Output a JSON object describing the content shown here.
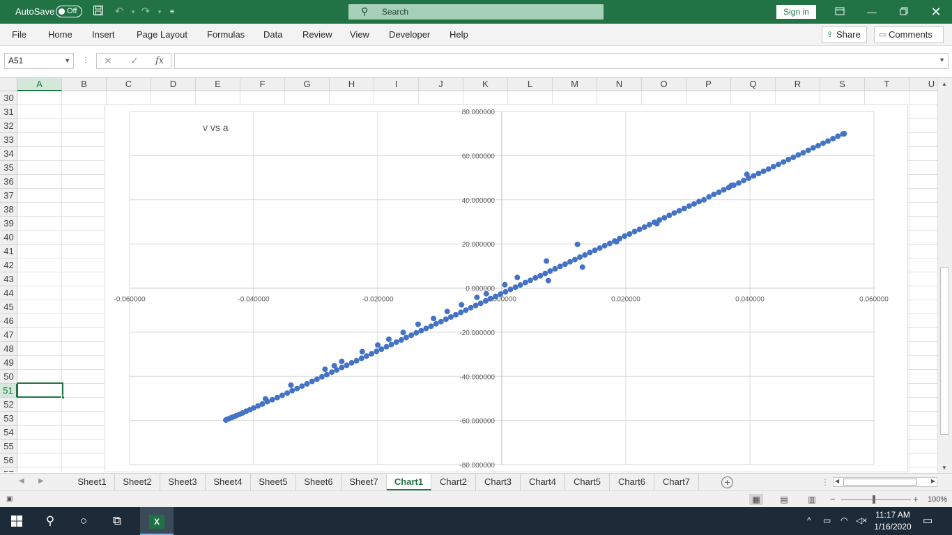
{
  "titlebar": {
    "autosave_label": "AutoSave",
    "autosave_state": "Off",
    "search_placeholder": "Search",
    "signin_label": "Sign in"
  },
  "ribbon": {
    "tabs": [
      "File",
      "Home",
      "Insert",
      "Page Layout",
      "Formulas",
      "Data",
      "Review",
      "View",
      "Developer",
      "Help"
    ],
    "share_label": "Share",
    "comments_label": "Comments"
  },
  "formula_bar": {
    "name_box": "A51",
    "fx_label": "fx",
    "formula_value": ""
  },
  "grid": {
    "columns": [
      "A",
      "B",
      "C",
      "D",
      "E",
      "F",
      "G",
      "H",
      "I",
      "J",
      "K",
      "L",
      "M",
      "N",
      "O",
      "P",
      "Q",
      "R",
      "S",
      "T",
      "U"
    ],
    "selected_column": "A",
    "rows": [
      "30",
      "31",
      "32",
      "33",
      "34",
      "35",
      "36",
      "37",
      "38",
      "39",
      "40",
      "41",
      "42",
      "43",
      "44",
      "45",
      "46",
      "47",
      "48",
      "49",
      "50",
      "51",
      "52",
      "53",
      "54",
      "55",
      "56",
      "57"
    ],
    "selected_row": "51"
  },
  "chart_data": {
    "type": "scatter",
    "title": "v vs a",
    "xlabel": "",
    "ylabel": "",
    "xlim": [
      -0.06,
      0.06
    ],
    "ylim": [
      -80,
      80
    ],
    "x_ticks": [
      "-0.060000",
      "-0.040000",
      "-0.020000",
      "0.000000",
      "0.020000",
      "0.040000",
      "0.060000"
    ],
    "y_ticks": [
      "80.000000",
      "60.000000",
      "40.000000",
      "20.000000",
      "0.000000",
      "-20.000000",
      "-40.000000",
      "-60.000000",
      "-80.000000"
    ],
    "grid": true,
    "marker_color": "#4472c4",
    "points": [
      [
        -0.0445,
        -59.8
      ],
      [
        -0.0443,
        -59.5
      ],
      [
        -0.044,
        -59.2
      ],
      [
        -0.0436,
        -58.7
      ],
      [
        -0.0432,
        -58.3
      ],
      [
        -0.0428,
        -57.8
      ],
      [
        -0.0423,
        -57.2
      ],
      [
        -0.0418,
        -56.6
      ],
      [
        -0.0412,
        -55.8
      ],
      [
        -0.0406,
        -55.1
      ],
      [
        -0.04,
        -54.3
      ],
      [
        -0.0393,
        -53.4
      ],
      [
        -0.0386,
        -52.5
      ],
      [
        -0.0378,
        -51.4
      ],
      [
        -0.0381,
        -50.2
      ],
      [
        -0.037,
        -50.6
      ],
      [
        -0.0362,
        -49.6
      ],
      [
        -0.0354,
        -48.6
      ],
      [
        -0.0346,
        -47.6
      ],
      [
        -0.0338,
        -46.5
      ],
      [
        -0.033,
        -45.5
      ],
      [
        -0.034,
        -44.0
      ],
      [
        -0.0322,
        -44.4
      ],
      [
        -0.0314,
        -43.4
      ],
      [
        -0.0306,
        -42.3
      ],
      [
        -0.0298,
        -41.3
      ],
      [
        -0.029,
        -40.2
      ],
      [
        -0.0282,
        -39.2
      ],
      [
        -0.0274,
        -38.1
      ],
      [
        -0.0285,
        -36.8
      ],
      [
        -0.0266,
        -37.1
      ],
      [
        -0.027,
        -35.2
      ],
      [
        -0.0258,
        -36.0
      ],
      [
        -0.025,
        -35.0
      ],
      [
        -0.0258,
        -33.2
      ],
      [
        -0.0242,
        -33.9
      ],
      [
        -0.0234,
        -32.9
      ],
      [
        -0.0226,
        -31.8
      ],
      [
        -0.0218,
        -30.8
      ],
      [
        -0.021,
        -29.8
      ],
      [
        -0.0225,
        -28.8
      ],
      [
        -0.0202,
        -28.7
      ],
      [
        -0.0194,
        -27.7
      ],
      [
        -0.02,
        -25.8
      ],
      [
        -0.0186,
        -26.6
      ],
      [
        -0.0178,
        -25.6
      ],
      [
        -0.017,
        -24.5
      ],
      [
        -0.0182,
        -23.2
      ],
      [
        -0.0162,
        -23.5
      ],
      [
        -0.0154,
        -22.4
      ],
      [
        -0.0146,
        -21.4
      ],
      [
        -0.0159,
        -20.1
      ],
      [
        -0.0138,
        -20.3
      ],
      [
        -0.013,
        -19.3
      ],
      [
        -0.0122,
        -18.3
      ],
      [
        -0.0135,
        -16.4
      ],
      [
        -0.0114,
        -17.3
      ],
      [
        -0.0106,
        -16.2
      ],
      [
        -0.0098,
        -15.2
      ],
      [
        -0.011,
        -13.8
      ],
      [
        -0.009,
        -14.1
      ],
      [
        -0.0082,
        -13.1
      ],
      [
        -0.0074,
        -12.1
      ],
      [
        -0.0088,
        -10.6
      ],
      [
        -0.0066,
        -11.0
      ],
      [
        -0.0058,
        -10.0
      ],
      [
        -0.005,
        -8.9
      ],
      [
        -0.0065,
        -7.6
      ],
      [
        -0.0042,
        -7.9
      ],
      [
        -0.0034,
        -6.9
      ],
      [
        -0.0026,
        -5.8
      ],
      [
        -0.004,
        -4.2
      ],
      [
        -0.0018,
        -4.8
      ],
      [
        -0.001,
        -3.8
      ],
      [
        -0.0025,
        -2.6
      ],
      [
        -0.0002,
        -2.7
      ],
      [
        0.0006,
        -1.7
      ],
      [
        0.0014,
        -0.6
      ],
      [
        0.0005,
        1.5
      ],
      [
        0.0022,
        0.4
      ],
      [
        0.003,
        1.4
      ],
      [
        0.0038,
        2.5
      ],
      [
        0.0025,
        4.8
      ],
      [
        0.0046,
        3.5
      ],
      [
        0.0054,
        4.6
      ],
      [
        0.0062,
        5.6
      ],
      [
        0.0075,
        3.4
      ],
      [
        0.007,
        6.6
      ],
      [
        0.0078,
        7.7
      ],
      [
        0.0086,
        8.7
      ],
      [
        0.0072,
        12.2
      ],
      [
        0.0094,
        9.8
      ],
      [
        0.0102,
        10.8
      ],
      [
        0.011,
        11.9
      ],
      [
        0.0118,
        12.9
      ],
      [
        0.013,
        9.5
      ],
      [
        0.0126,
        14.0
      ],
      [
        0.0134,
        15.0
      ],
      [
        0.0122,
        19.8
      ],
      [
        0.0142,
        16.1
      ],
      [
        0.015,
        17.1
      ],
      [
        0.0158,
        18.1
      ],
      [
        0.0166,
        19.2
      ],
      [
        0.0174,
        20.2
      ],
      [
        0.0185,
        21.0
      ],
      [
        0.0182,
        21.3
      ],
      [
        0.019,
        22.4
      ],
      [
        0.0198,
        23.5
      ],
      [
        0.0206,
        24.5
      ],
      [
        0.0214,
        25.6
      ],
      [
        0.0222,
        26.6
      ],
      [
        0.023,
        27.6
      ],
      [
        0.0238,
        28.7
      ],
      [
        0.0246,
        29.8
      ],
      [
        0.025,
        29.2
      ],
      [
        0.0254,
        30.8
      ],
      [
        0.0262,
        31.8
      ],
      [
        0.027,
        32.9
      ],
      [
        0.0278,
        34.0
      ],
      [
        0.0286,
        35.0
      ],
      [
        0.0294,
        36.0
      ],
      [
        0.0302,
        37.1
      ],
      [
        0.031,
        38.1
      ],
      [
        0.0318,
        39.2
      ],
      [
        0.0326,
        40.0
      ],
      [
        0.0334,
        41.3
      ],
      [
        0.0342,
        42.4
      ],
      [
        0.035,
        43.4
      ],
      [
        0.0358,
        44.5
      ],
      [
        0.0366,
        45.5
      ],
      [
        0.037,
        46.5
      ],
      [
        0.0374,
        46.6
      ],
      [
        0.0382,
        47.6
      ],
      [
        0.039,
        48.7
      ],
      [
        0.0398,
        49.8
      ],
      [
        0.0406,
        50.8
      ],
      [
        0.0395,
        51.5
      ],
      [
        0.0414,
        51.9
      ],
      [
        0.0422,
        52.9
      ],
      [
        0.043,
        53.9
      ],
      [
        0.0438,
        55.0
      ],
      [
        0.0446,
        56.0
      ],
      [
        0.0454,
        57.1
      ],
      [
        0.0462,
        58.2
      ],
      [
        0.047,
        59.2
      ],
      [
        0.0478,
        60.3
      ],
      [
        0.0486,
        61.3
      ],
      [
        0.0494,
        62.4
      ],
      [
        0.0502,
        63.5
      ],
      [
        0.051,
        64.5
      ],
      [
        0.0518,
        65.6
      ],
      [
        0.0526,
        66.6
      ],
      [
        0.0534,
        67.7
      ],
      [
        0.0542,
        68.8
      ],
      [
        0.055,
        69.8
      ],
      [
        0.0552,
        69.9
      ]
    ]
  },
  "sheet_tabs": {
    "tabs": [
      "Sheet1",
      "Sheet2",
      "Sheet3",
      "Sheet4",
      "Sheet5",
      "Sheet6",
      "Sheet7",
      "Chart1",
      "Chart2",
      "Chart3",
      "Chart4",
      "Chart5",
      "Chart6",
      "Chart7"
    ],
    "active": "Chart1"
  },
  "statusbar": {
    "zoom_minus": "−",
    "zoom_plus": "+",
    "zoom_level": "100%"
  },
  "taskbar": {
    "time": "11:17 AM",
    "date": "1/16/2020"
  },
  "colors": {
    "excel_green": "#217346",
    "marker_blue": "#4472c4"
  }
}
